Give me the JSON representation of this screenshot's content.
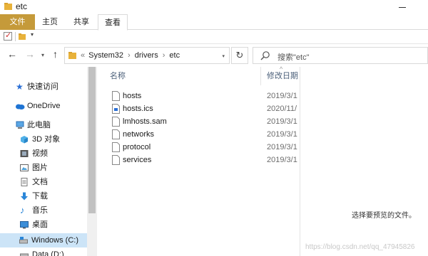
{
  "window": {
    "title": "etc"
  },
  "ribbon": {
    "tabs": [
      "文件",
      "主页",
      "共享",
      "查看"
    ]
  },
  "address": {
    "breadcrumbs": [
      "System32",
      "drivers",
      "etc"
    ],
    "overflow": "«"
  },
  "search": {
    "placeholder": "搜索\"etc\""
  },
  "sidebar": {
    "items": [
      {
        "label": "快速访问",
        "icon": "star-icon"
      },
      {
        "label": "OneDrive",
        "icon": "cloud-icon"
      },
      {
        "label": "此电脑",
        "icon": "computer-icon"
      },
      {
        "label": "3D 对象",
        "icon": "3d-objects-icon"
      },
      {
        "label": "视频",
        "icon": "video-icon"
      },
      {
        "label": "图片",
        "icon": "pictures-icon"
      },
      {
        "label": "文档",
        "icon": "documents-icon"
      },
      {
        "label": "下载",
        "icon": "download-icon"
      },
      {
        "label": "音乐",
        "icon": "music-icon"
      },
      {
        "label": "桌面",
        "icon": "desktop-icon"
      },
      {
        "label": "Windows (C:)",
        "icon": "drive-icon"
      },
      {
        "label": "Data (D:)",
        "icon": "drive-icon"
      }
    ],
    "selected": "Windows (C:)"
  },
  "files": {
    "columns": {
      "name": "名称",
      "date": "修改日期"
    },
    "sort_indicator": "^",
    "rows": [
      {
        "name": "hosts",
        "date": "2019/3/1",
        "icon": "file-icon"
      },
      {
        "name": "hosts.ics",
        "date": "2020/11/",
        "icon": "ics-file-icon"
      },
      {
        "name": "lmhosts.sam",
        "date": "2019/3/1",
        "icon": "file-icon"
      },
      {
        "name": "networks",
        "date": "2019/3/1",
        "icon": "file-icon"
      },
      {
        "name": "protocol",
        "date": "2019/3/1",
        "icon": "file-icon"
      },
      {
        "name": "services",
        "date": "2019/3/1",
        "icon": "file-icon"
      }
    ]
  },
  "preview": {
    "message": "选择要预览的文件。"
  },
  "watermark": "https://blog.csdn.net/qq_47945826",
  "colors": {
    "file_tab": "#c59a3a",
    "selected": "#cce4f7",
    "folder": "#e8b23a",
    "column_header": "#4c607a"
  }
}
